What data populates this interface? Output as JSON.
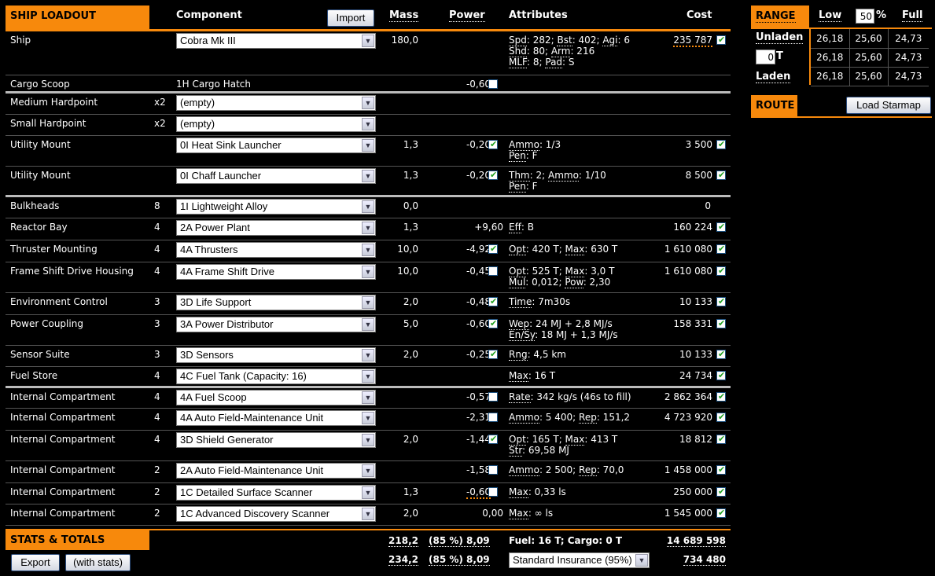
{
  "header": {
    "title": "SHIP LOADOUT",
    "component": "Component",
    "import": "Import",
    "mass": "Mass",
    "power": "Power",
    "attributes": "Attributes",
    "cost": "Cost"
  },
  "rows": [
    {
      "label": "Ship",
      "cls": "",
      "select": "Cobra Mk III",
      "mass": "180,0",
      "power": "",
      "pcb": null,
      "attr": [
        "Spd: 282; Bst: 402; Agi: 6",
        "Shd: 80; Arm: 216",
        "MLF: 8; Pad: S"
      ],
      "cost": "235 787",
      "ccb": true,
      "costwarn": true
    },
    {
      "label": "Cargo Scoop",
      "cls": "",
      "text": "1H Cargo Hatch",
      "mass": "",
      "power": "-0,60",
      "pcb": false,
      "attr": [],
      "cost": "",
      "ccb": null,
      "sep": true
    },
    {
      "label": "Medium Hardpoint",
      "cls": "x2",
      "select": "(empty)",
      "mass": "",
      "power": "",
      "pcb": null,
      "attr": [],
      "cost": "",
      "ccb": null
    },
    {
      "label": "Small Hardpoint",
      "cls": "x2",
      "select": "(empty)",
      "mass": "",
      "power": "",
      "pcb": null,
      "attr": [],
      "cost": "",
      "ccb": null
    },
    {
      "label": "Utility Mount",
      "cls": "",
      "select": "0I Heat Sink Launcher",
      "mass": "1,3",
      "power": "-0,20",
      "pcb": true,
      "attr": [
        "Ammo: 1/3",
        "Pen: F"
      ],
      "cost": "3 500",
      "ccb": true
    },
    {
      "label": "Utility Mount",
      "cls": "",
      "select": "0I Chaff Launcher",
      "mass": "1,3",
      "power": "-0,20",
      "pcb": true,
      "attr": [
        "Thm: 2; Ammo: 1/10",
        "Pen: F"
      ],
      "cost": "8 500",
      "ccb": true,
      "sep": true
    },
    {
      "label": "Bulkheads",
      "cls": "8",
      "select": "1I Lightweight Alloy",
      "mass": "0,0",
      "power": "",
      "pcb": null,
      "attr": [],
      "cost": "0",
      "ccb": null
    },
    {
      "label": "Reactor Bay",
      "cls": "4",
      "select": "2A Power Plant",
      "mass": "1,3",
      "power": "+9,60",
      "pcb": null,
      "attr": [
        "Eff: B"
      ],
      "cost": "160 224",
      "ccb": true
    },
    {
      "label": "Thruster Mounting",
      "cls": "4",
      "select": "4A Thrusters",
      "mass": "10,0",
      "power": "-4,92",
      "pcb": true,
      "attr": [
        "Opt: 420 T; Max: 630 T"
      ],
      "cost": "1 610 080",
      "ccb": true
    },
    {
      "label": "Frame Shift Drive Housing",
      "cls": "4",
      "select": "4A Frame Shift Drive",
      "mass": "10,0",
      "power": "-0,45",
      "pcb": false,
      "attr": [
        "Opt: 525 T; Max: 3,0 T",
        "Mul: 0,012; Pow: 2,30"
      ],
      "cost": "1 610 080",
      "ccb": true
    },
    {
      "label": "Environment Control",
      "cls": "3",
      "select": "3D Life Support",
      "mass": "2,0",
      "power": "-0,48",
      "pcb": true,
      "attr": [
        "Time: 7m30s"
      ],
      "cost": "10 133",
      "ccb": true
    },
    {
      "label": "Power Coupling",
      "cls": "3",
      "select": "3A Power Distributor",
      "mass": "5,0",
      "power": "-0,60",
      "pcb": true,
      "attr": [
        "Wep: 24 MJ + 2,8 MJ/s",
        "En/Sy: 18 MJ + 1,3 MJ/s"
      ],
      "cost": "158 331",
      "ccb": true
    },
    {
      "label": "Sensor Suite",
      "cls": "3",
      "select": "3D Sensors",
      "mass": "2,0",
      "power": "-0,25",
      "pcb": true,
      "attr": [
        "Rng: 4,5 km"
      ],
      "cost": "10 133",
      "ccb": true
    },
    {
      "label": "Fuel Store",
      "cls": "4",
      "select": "4C Fuel Tank (Capacity: 16)",
      "mass": "",
      "power": "",
      "pcb": null,
      "attr": [
        "Max: 16 T"
      ],
      "cost": "24 734",
      "ccb": true,
      "sep": true
    },
    {
      "label": "Internal Compartment",
      "cls": "4",
      "select": "4A Fuel Scoop",
      "mass": "",
      "power": "-0,57",
      "pcb": false,
      "attr": [
        "Rate: 342 kg/s (46s to fill)"
      ],
      "cost": "2 862 364",
      "ccb": true
    },
    {
      "label": "Internal Compartment",
      "cls": "4",
      "select": "4A Auto Field-Maintenance Unit",
      "mass": "",
      "power": "-2,31",
      "pcb": false,
      "attr": [
        "Ammo: 5 400; Rep: 151,2"
      ],
      "cost": "4 723 920",
      "ccb": true
    },
    {
      "label": "Internal Compartment",
      "cls": "4",
      "select": "3D Shield Generator",
      "mass": "2,0",
      "power": "-1,44",
      "pcb": true,
      "attr": [
        "Opt: 165 T; Max: 413 T",
        "Str: 69,58 MJ"
      ],
      "cost": "18 812",
      "ccb": true
    },
    {
      "label": "Internal Compartment",
      "cls": "2",
      "select": "2A Auto Field-Maintenance Unit",
      "mass": "",
      "power": "-1,58",
      "pcb": false,
      "attr": [
        "Ammo: 2 500; Rep: 70,0"
      ],
      "cost": "1 458 000",
      "ccb": true
    },
    {
      "label": "Internal Compartment",
      "cls": "2",
      "select": "1C Detailed Surface Scanner",
      "mass": "1,3",
      "power": "-0,60",
      "pcb": false,
      "powwarn": true,
      "attr": [
        "Max: 0,33 ls"
      ],
      "cost": "250 000",
      "ccb": true
    },
    {
      "label": "Internal Compartment",
      "cls": "2",
      "select": "1C Advanced Discovery Scanner",
      "mass": "2,0",
      "power": "0,00",
      "pcb": null,
      "attr": [
        "Max: ∞ ls"
      ],
      "cost": "1 545 000",
      "ccb": true
    }
  ],
  "stats": {
    "title": "STATS & TOTALS",
    "export": "Export",
    "with_stats": "(with stats)",
    "mass1": "218,2",
    "power1": "(85 %) 8,09",
    "fuelcargo": "Fuel: 16 T; Cargo: 0 T",
    "cost1": "14 689 598",
    "mass2": "234,2",
    "power2": "(85 %) 8,09",
    "insurance": "Standard Insurance (95%)",
    "cost2": "734 480"
  },
  "range": {
    "title": "RANGE",
    "low": "Low",
    "pct": "50",
    "pct_sign": "%",
    "full": "Full",
    "unladen": "Unladen",
    "cargo": "0",
    "cargo_unit": "T",
    "laden": "Laden",
    "values": [
      [
        "26,18",
        "25,60",
        "24,73"
      ],
      [
        "26,18",
        "25,60",
        "24,73"
      ],
      [
        "26,18",
        "25,60",
        "24,73"
      ]
    ]
  },
  "route": {
    "title": "ROUTE",
    "load": "Load Starmap"
  }
}
